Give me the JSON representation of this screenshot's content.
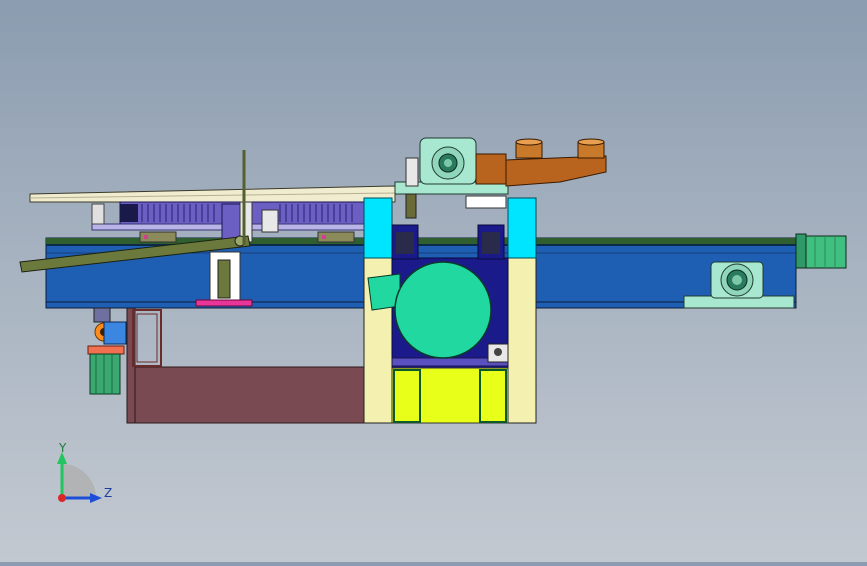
{
  "triad": {
    "y_label": "Y",
    "z_label": "Z",
    "colors": {
      "y": "#22c55e",
      "z": "#1d4ed8",
      "origin": "#dc2626"
    }
  },
  "colors": {
    "frame_blue": "#1e5fb3",
    "frame_stripe": "#2f5f2f",
    "bed_top": "#f0ecd0",
    "chain_purple": "#6b5fc4",
    "olive_arm": "#6b7a3c",
    "pillar_cyan": "#00e5ff",
    "pillar_cream": "#f3f0b0",
    "roller_green": "#20d8a0",
    "bearing_mint": "#a8e8d0",
    "bronze_arm": "#b8641e",
    "yellow_box": "#e8ff1a",
    "cabinet_brown": "#7a4a52",
    "motor_green": "#40c080",
    "navy": "#1a1a8a"
  }
}
